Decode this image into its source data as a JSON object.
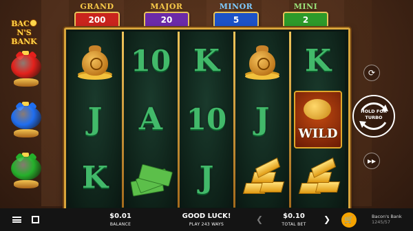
{
  "jackpots": [
    {
      "name": "GRAND",
      "value": "200",
      "title_color": "#f7c948",
      "box_color": "#c9241d"
    },
    {
      "name": "MAJOR",
      "value": "20",
      "title_color": "#f7c948",
      "box_color": "#6b2aa8"
    },
    {
      "name": "MINOR",
      "value": "5",
      "title_color": "#7ecbff",
      "box_color": "#1c52c7"
    },
    {
      "name": "MINI",
      "value": "2",
      "title_color": "#9be37a",
      "box_color": "#2d9a2a"
    }
  ],
  "logo": {
    "line1": "BAC",
    "line1b": "N'S",
    "line2": "BANK"
  },
  "piggies": [
    {
      "name": "red",
      "color": "#e3211c"
    },
    {
      "name": "blue",
      "color": "#1f6ef0"
    },
    {
      "name": "green",
      "color": "#25b02b"
    }
  ],
  "reels": [
    [
      "money-bag",
      "J",
      "K"
    ],
    [
      "10",
      "A",
      "cash-stack"
    ],
    [
      "K",
      "10",
      "J"
    ],
    [
      "money-bag",
      "J",
      "gold-bars"
    ],
    [
      "K",
      "WILD",
      "gold-bars"
    ]
  ],
  "wild_label": "WILD",
  "controls": {
    "spin_label_1": "HOLD FOR",
    "spin_label_2": "TURBO"
  },
  "bottom": {
    "balance_value": "$0.01",
    "balance_label": "BALANCE",
    "message": "GOOD LUCK!",
    "ways": "PLAY 243 WAYS",
    "bet_value": "$0.10",
    "bet_label": "TOTAL BET",
    "game_title": "Bacon's Bank",
    "game_code": "1245/57"
  },
  "colors": {
    "accent": "#f5a300",
    "frame_gold": "#d9a53b",
    "symbol_green": "#42b96a"
  }
}
